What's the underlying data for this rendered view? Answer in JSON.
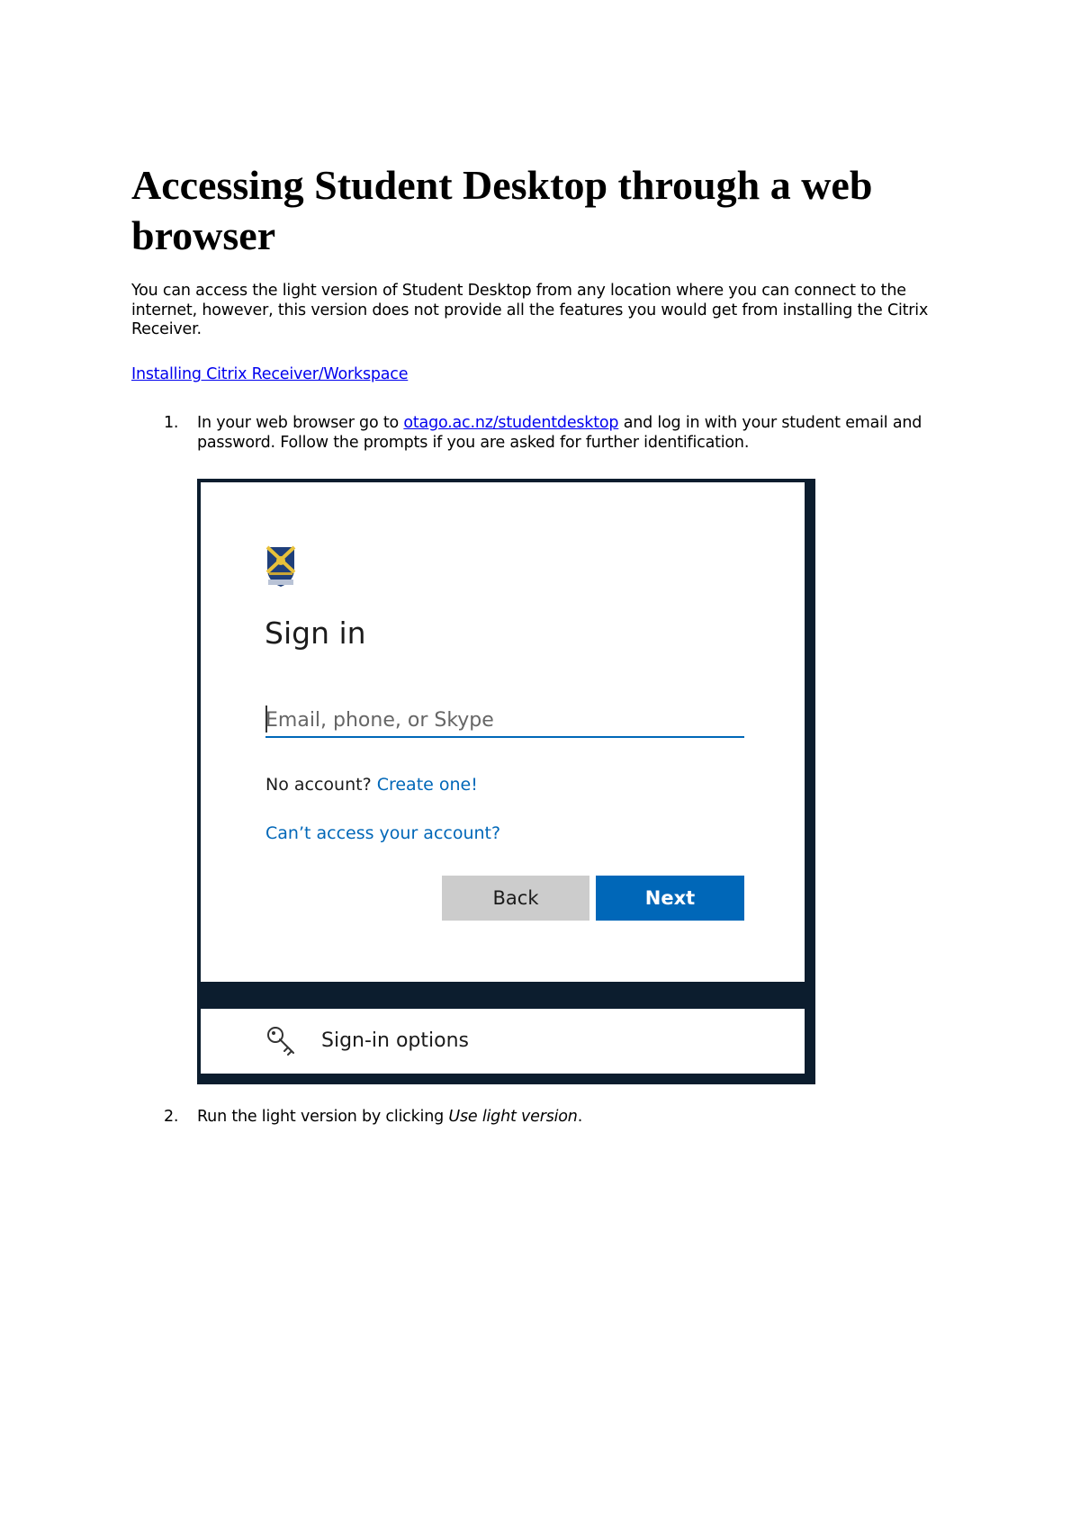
{
  "document": {
    "title": "Accessing Student Desktop through a web browser",
    "intro": "You can access the light version of Student Desktop from any location where you can connect to the internet, however, this version does not provide all the features you would get from installing the Citrix Receiver.",
    "top_link": "Installing Citrix Receiver/Workspace",
    "steps": [
      {
        "number": "1.",
        "text_before_link": "In your web browser go to ",
        "link": "otago.ac.nz/studentdesktop",
        "text_after_link": " and log in with your student email and password. Follow the prompts if you are asked for further identification."
      },
      {
        "number": "2.",
        "text_before": "Run the light version by clicking ",
        "emphasis": "Use light version",
        "text_after": "."
      }
    ]
  },
  "signin_screenshot": {
    "title": "Sign in",
    "email_placeholder": "Email, phone, or Skype",
    "no_account_text": "No account? ",
    "create_link": "Create one!",
    "cant_access_link": "Can’t access your account?",
    "back_label": "Back",
    "next_label": "Next",
    "options_label": "Sign-in options",
    "icons": [
      "university-crest-icon",
      "key-icon"
    ],
    "colors": {
      "accent": "#0067b8",
      "frame": "#0c1d2e",
      "back_button": "#cccccc"
    }
  }
}
